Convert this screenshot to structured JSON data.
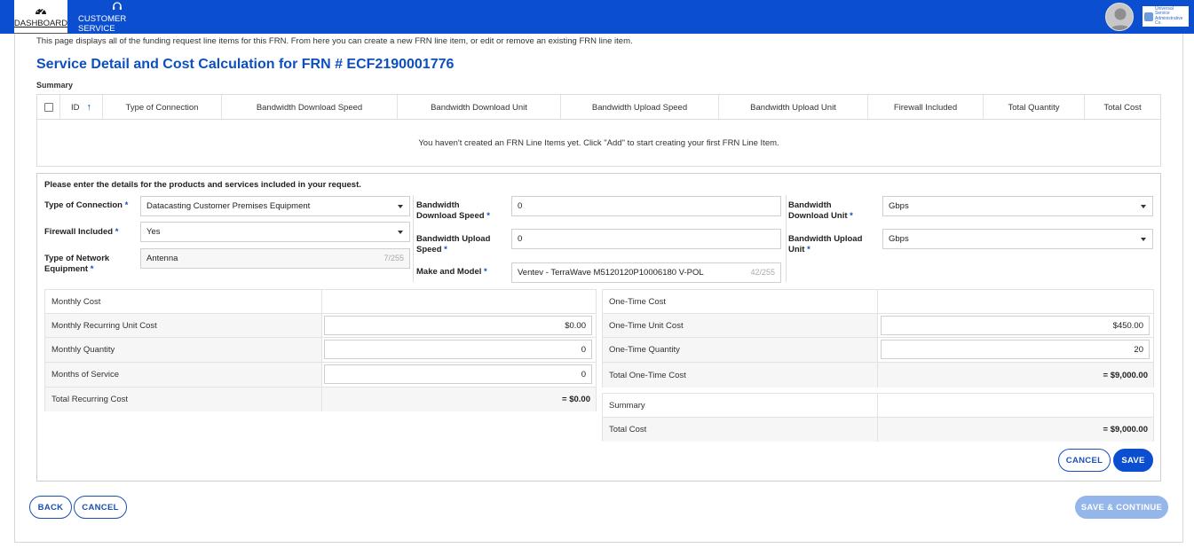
{
  "nav": {
    "dashboard_label": "DASHBOARD",
    "customer_service_label": "CUSTOMER SERVICE"
  },
  "branding": {
    "logo_text": "Universal Service Administrative Co."
  },
  "page": {
    "intro": "This page displays all of the funding request line items for this FRN. From here you can create a new FRN line item, or edit or remove an existing FRN line item.",
    "title": "Service Detail and Cost Calculation for FRN # ECF2190001776",
    "summary_label": "Summary"
  },
  "summary_table": {
    "columns": [
      "ID",
      "Type of Connection",
      "Bandwidth Download Speed",
      "Bandwidth Download Unit",
      "Bandwidth Upload Speed",
      "Bandwidth Upload Unit",
      "Firewall Included",
      "Total Quantity",
      "Total Cost"
    ],
    "empty_message": "You haven't created an FRN Line Items yet. Click \"Add\" to start creating your first FRN Line Item."
  },
  "details": {
    "heading": "Please enter the details for the products and services included in your request.",
    "type_of_connection": {
      "label": "Type of Connection",
      "value": "Datacasting Customer Premises Equipment"
    },
    "firewall_included": {
      "label": "Firewall Included",
      "value": "Yes"
    },
    "type_of_network_equipment": {
      "label_line1": "Type of Network",
      "label_line2": "Equipment",
      "value": "Antenna",
      "counter": "7/255"
    },
    "bandwidth_download_speed": {
      "label_line1": "Bandwidth",
      "label_line2": "Download Speed",
      "value": "0"
    },
    "bandwidth_upload_speed": {
      "label_line1": "Bandwidth Upload",
      "label_line2": "Speed",
      "value": "0"
    },
    "make_and_model": {
      "label": "Make and Model",
      "value": "Ventev - TerraWave M5120120P10006180 V-POL",
      "counter": "42/255"
    },
    "bandwidth_download_unit": {
      "label_line1": "Bandwidth",
      "label_line2": "Download Unit",
      "value": "Gbps"
    },
    "bandwidth_upload_unit": {
      "label_line1": "Bandwidth Upload",
      "label_line2": "Unit",
      "value": "Gbps"
    },
    "required_marker": "*"
  },
  "monthly_cost": {
    "header": "Monthly Cost",
    "rows": [
      {
        "label": "Monthly Recurring Unit Cost",
        "value": "$0.00"
      },
      {
        "label": "Monthly Quantity",
        "value": "0"
      },
      {
        "label": "Months of Service",
        "value": "0"
      }
    ],
    "total_label": "Total Recurring Cost",
    "total_value": "= $0.00"
  },
  "one_time_cost": {
    "header": "One-Time Cost",
    "rows": [
      {
        "label": "One-Time Unit Cost",
        "value": "$450.00"
      },
      {
        "label": "One-Time Quantity",
        "value": "20"
      }
    ],
    "total_label": "Total One-Time Cost",
    "total_value": "= $9,000.00"
  },
  "cost_summary": {
    "header": "Summary",
    "total_label": "Total Cost",
    "total_value": "= $9,000.00"
  },
  "buttons": {
    "cancel_inner": "CANCEL",
    "save": "SAVE",
    "back": "BACK",
    "cancel": "CANCEL",
    "save_continue": "SAVE & CONTINUE"
  }
}
